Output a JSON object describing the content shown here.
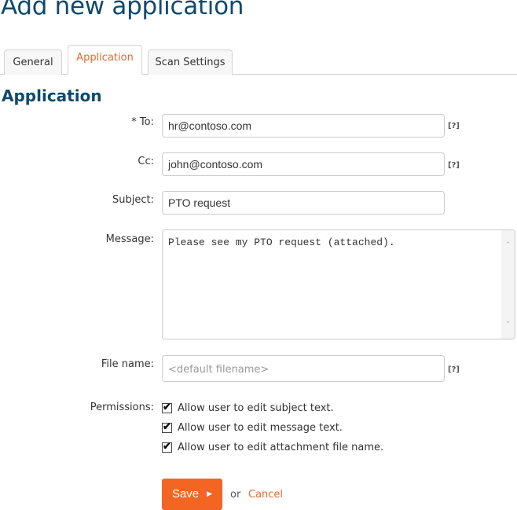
{
  "page": {
    "title": "Add new application"
  },
  "tabs": [
    {
      "label": "General",
      "active": false
    },
    {
      "label": "Application",
      "active": true
    },
    {
      "label": "Scan Settings",
      "active": false
    }
  ],
  "section": {
    "title": "Application"
  },
  "form": {
    "to": {
      "label": "* To:",
      "value": "hr@contoso.com",
      "help": "[?]"
    },
    "cc": {
      "label": "Cc:",
      "value": "john@contoso.com",
      "help": "[?]"
    },
    "subject": {
      "label": "Subject:",
      "value": "PTO request"
    },
    "message": {
      "label": "Message:",
      "value": "Please see my PTO request (attached)."
    },
    "filename": {
      "label": "File name:",
      "value": "",
      "placeholder": "<default filename>",
      "help": "[?]"
    },
    "permissions": {
      "label": "Permissions:",
      "items": [
        {
          "label": "Allow user to edit subject text.",
          "checked": true
        },
        {
          "label": "Allow user to edit message text.",
          "checked": true
        },
        {
          "label": "Allow user to edit attachment file name.",
          "checked": true
        }
      ]
    }
  },
  "actions": {
    "save_label": "Save",
    "or_text": "or",
    "cancel_label": "Cancel"
  },
  "colors": {
    "accent": "#f26522",
    "title": "#0f4a6e",
    "active_tab": "#e8692c"
  }
}
